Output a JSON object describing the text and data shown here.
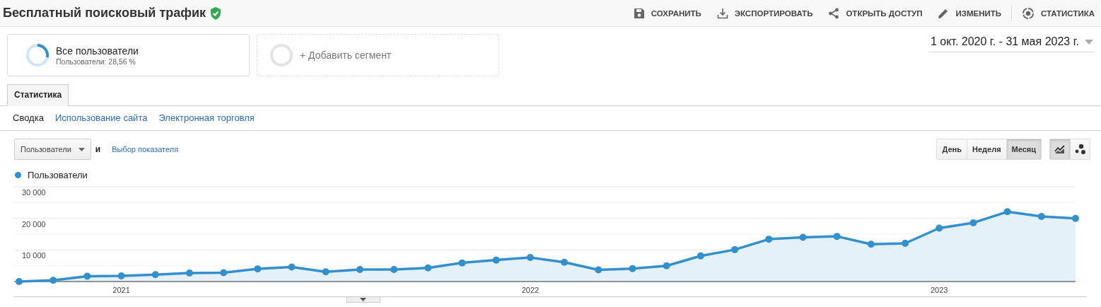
{
  "header": {
    "title": "Бесплатный поисковый трафик",
    "actions": [
      {
        "kind": "save",
        "label": "СОХРАНИТЬ",
        "separated": false
      },
      {
        "kind": "export",
        "label": "ЭКСПОРТИРОВАТЬ",
        "separated": false
      },
      {
        "kind": "share",
        "label": "ОТКРЫТЬ ДОСТУП",
        "separated": false
      },
      {
        "kind": "edit",
        "label": "ИЗМЕНИТЬ",
        "separated": false
      },
      {
        "kind": "insights",
        "label": "СТАТИСТИКА",
        "separated": true
      }
    ]
  },
  "segments": [
    {
      "kind": "segment",
      "title": "Все пользователи",
      "subtitle": "Пользователи: 28,56 %",
      "level": 0.2856
    },
    {
      "kind": "add",
      "title": "+ Добавить сегмент"
    }
  ],
  "date_range": "1 окт. 2020 г. - 31 мая 2023 г.",
  "tabs": [
    {
      "label": "Статистика",
      "selected": true
    }
  ],
  "subnav": [
    {
      "label": "Сводка",
      "selected": true
    },
    {
      "label": "Использование сайта",
      "selected": false
    },
    {
      "label": "Электронная торговля",
      "selected": false
    }
  ],
  "metric_select": {
    "value": "Пользователи"
  },
  "conjunction": "и",
  "metric_link": "Выбор показателя",
  "granularity": [
    {
      "label": "День",
      "selected": false
    },
    {
      "label": "Неделя",
      "selected": false
    },
    {
      "label": "Месяц",
      "selected": true
    }
  ],
  "chart_types": [
    {
      "kind": "line",
      "selected": true
    },
    {
      "kind": "motion",
      "selected": false
    }
  ],
  "chart": {
    "chart_data": {
      "type": "area",
      "categories": [
        null,
        null,
        null,
        "2021",
        null,
        null,
        null,
        null,
        null,
        null,
        null,
        null,
        null,
        null,
        null,
        "2022",
        null,
        null,
        null,
        null,
        null,
        null,
        null,
        null,
        null,
        null,
        null,
        "2023",
        null,
        null,
        null,
        null
      ],
      "series": [
        {
          "name": "Пользователи",
          "color": "#3390cc",
          "values": [
            0,
            400,
            1700,
            1800,
            2200,
            2700,
            2800,
            4000,
            4600,
            3100,
            3800,
            3800,
            4300,
            5900,
            6800,
            7600,
            6100,
            3700,
            4100,
            5000,
            8100,
            10100,
            13400,
            14000,
            14300,
            11800,
            12100,
            16900,
            18600,
            22100,
            20600,
            20000
          ]
        }
      ],
      "yticks": [
        {
          "value": 10000,
          "label": "10 000"
        },
        {
          "value": 20000,
          "label": "20 000"
        },
        {
          "value": 30000,
          "label": "30 000"
        }
      ],
      "ylim": [
        0,
        30000
      ]
    }
  }
}
